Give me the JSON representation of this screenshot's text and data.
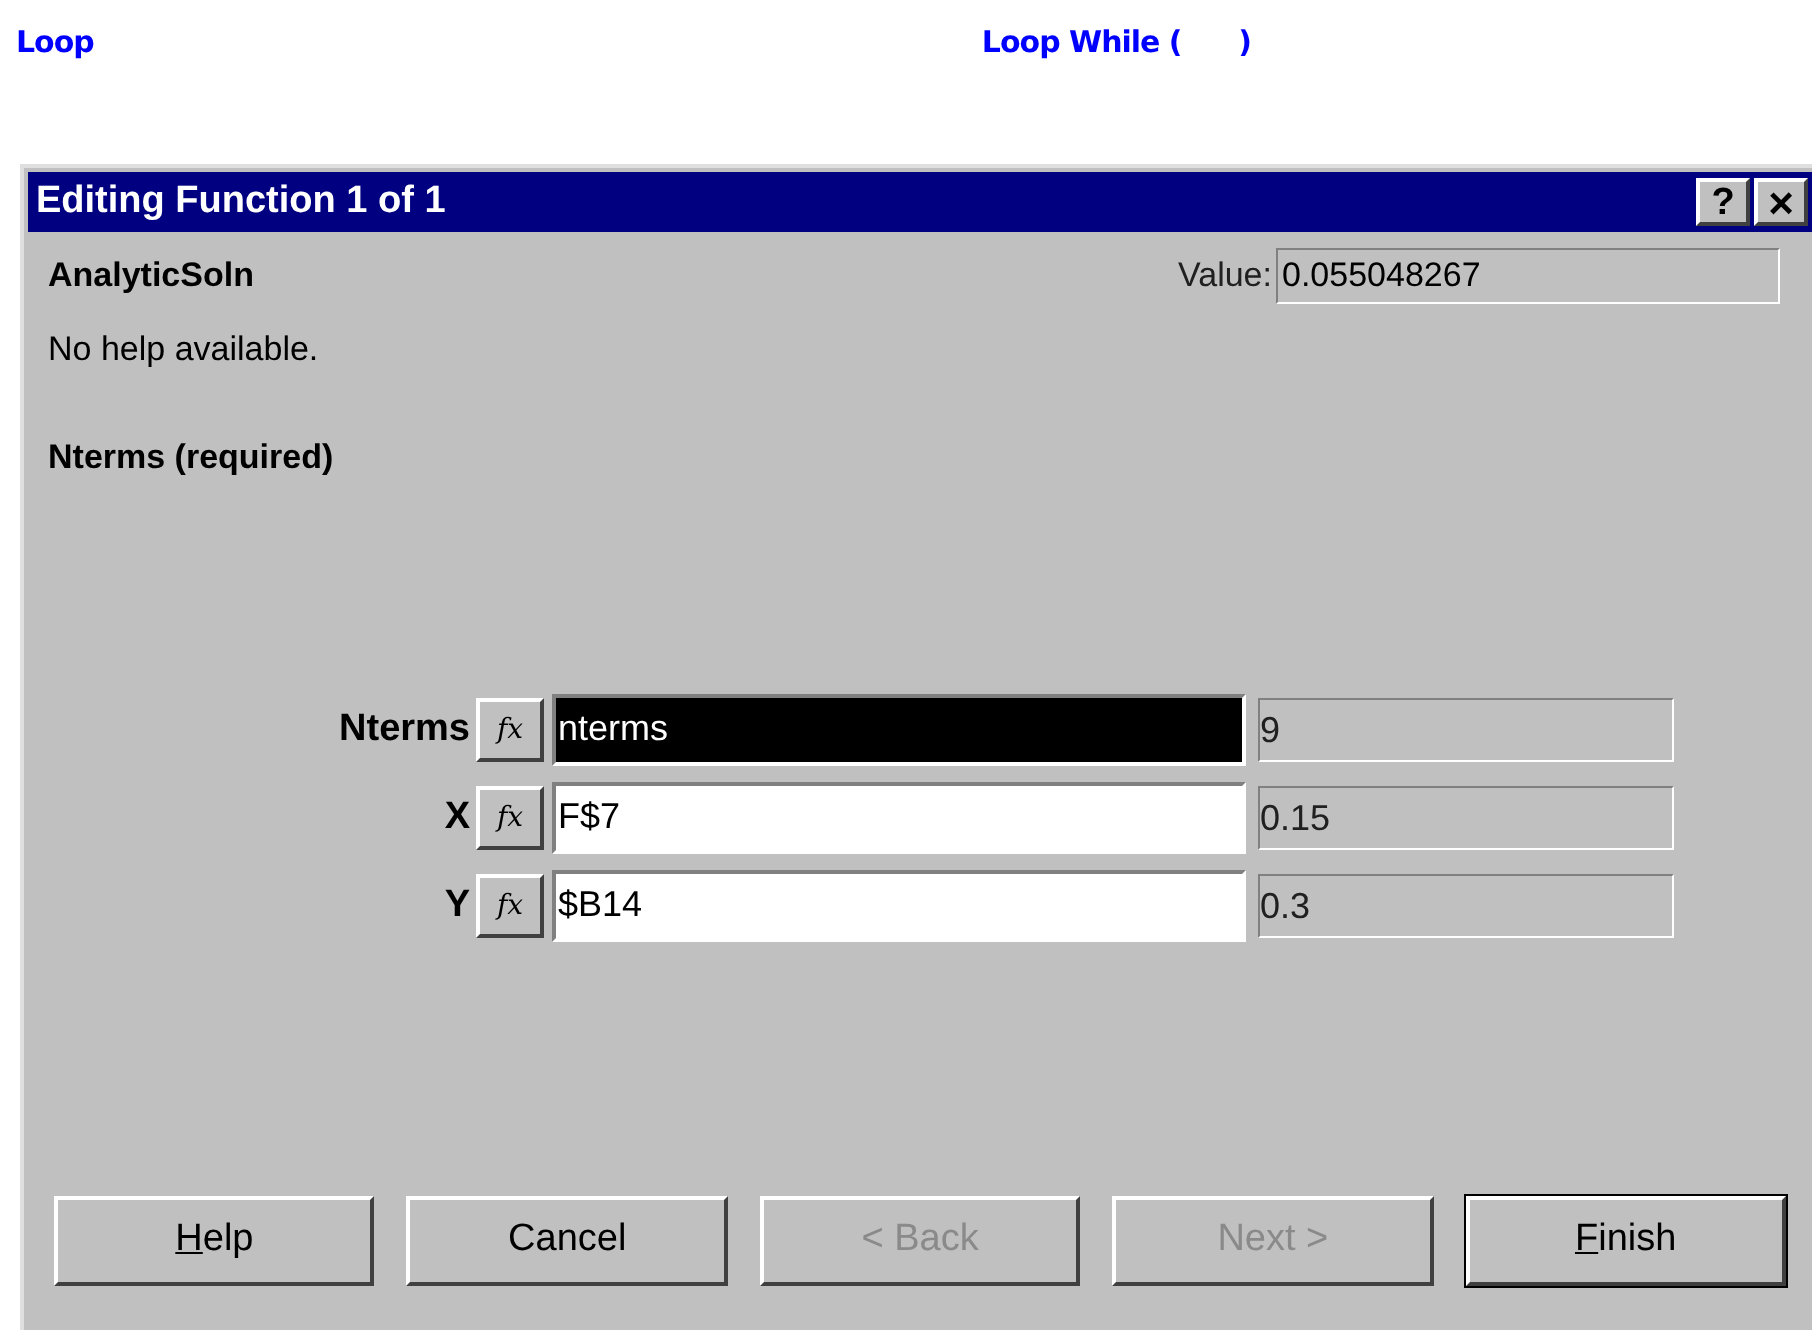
{
  "top_labels": [
    "Loop",
    "Loop While (      )"
  ],
  "window": {
    "title": "Editing Function 1 of 1",
    "help_button": "?",
    "close_button": "×"
  },
  "function_name": "AnalyticSoln",
  "value_label": "Value:",
  "value": "0.055048267",
  "help_text": "No help available.",
  "argument_heading": "Nterms (required)",
  "arguments": [
    {
      "name": "Nterms",
      "fx": "fx",
      "input": "nterms",
      "result": "9",
      "selected": true
    },
    {
      "name": "X",
      "fx": "fx",
      "input": "F$7",
      "result": "0.15",
      "selected": false
    },
    {
      "name": "Y",
      "fx": "fx",
      "input": "$B14",
      "result": "0.3",
      "selected": false
    }
  ],
  "buttons": [
    {
      "mnemonic": "H",
      "rest": "elp",
      "disabled": false,
      "default": false
    },
    {
      "rest": "Cancel",
      "disabled": false,
      "default": false
    },
    {
      "rest": "< Back",
      "disabled": true,
      "default": false
    },
    {
      "rest": "Next >",
      "disabled": true,
      "default": false
    },
    {
      "mnemonic": "F",
      "rest": "inish",
      "disabled": false,
      "default": true
    }
  ]
}
